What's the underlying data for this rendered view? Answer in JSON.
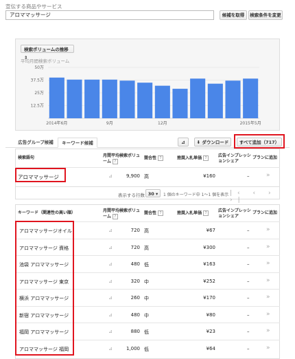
{
  "search": {
    "label": "宣伝する商品やサービス",
    "value": "アロママッサージ",
    "get_button": "候補を取得",
    "change_button": "検索条件を変更"
  },
  "trend": {
    "dropdown": "検索ボリュームの推移",
    "legend": "平均月間検索ボリューム"
  },
  "chart_data": {
    "type": "bar",
    "ylabel": "平均月間検索ボリューム",
    "yticks": [
      "50万",
      "37.5万",
      "25万",
      "12.5万"
    ],
    "ylim": [
      0,
      50000
    ],
    "values": [
      40000,
      38000,
      38000,
      38000,
      37000,
      35000,
      32000,
      29000,
      39000,
      34000,
      37000,
      39000
    ],
    "xticks": [
      "2014年6月",
      "9月",
      "12月",
      "2015年5月"
    ],
    "color": "#4a86e8"
  },
  "tabs": {
    "ad_group": "広告グループ候補",
    "keyword": "キーワード候補"
  },
  "toolbar": {
    "chart_icon": "chart-icon",
    "download": "ダウンロード",
    "add_all": "すべて追加（717）"
  },
  "table1": {
    "headers": {
      "keyword": "検索語句",
      "volume": "月間平均検索ボリューム",
      "competition": "競合性",
      "bid": "推奨入札単価",
      "share": "広告インプレッションシェア",
      "add": "プランに追加"
    },
    "row": {
      "keyword": "アロママッサージ",
      "volume": "9,900",
      "competition": "高",
      "bid": "¥160",
      "share": "–"
    }
  },
  "pager": {
    "label": "表示する行数",
    "rows": "30",
    "range": "1 個のキーワード中 1～1 個を表示"
  },
  "table2": {
    "headers": {
      "keyword": "キーワード（関連性の高い順）",
      "volume": "月間平均検索ボリューム",
      "competition": "競合性",
      "bid": "推奨入札単価",
      "share": "広告インプレッションシェア",
      "add": "プランに追加"
    },
    "rows": [
      {
        "keyword": "アロママッサージオイル",
        "volume": "720",
        "competition": "高",
        "bid": "¥67",
        "share": "–"
      },
      {
        "keyword": "アロママッサージ 資格",
        "volume": "720",
        "competition": "高",
        "bid": "¥300",
        "share": "–"
      },
      {
        "keyword": "池袋 アロママッサージ",
        "volume": "480",
        "competition": "低",
        "bid": "¥163",
        "share": "–"
      },
      {
        "keyword": "アロママッサージ 東京",
        "volume": "320",
        "competition": "中",
        "bid": "¥252",
        "share": "–"
      },
      {
        "keyword": "横浜 アロママッサージ",
        "volume": "260",
        "competition": "中",
        "bid": "¥170",
        "share": "–"
      },
      {
        "keyword": "新宿 アロママッサージ",
        "volume": "480",
        "competition": "中",
        "bid": "¥80",
        "share": "–"
      },
      {
        "keyword": "福岡 アロママッサージ",
        "volume": "880",
        "competition": "低",
        "bid": "¥23",
        "share": "–"
      },
      {
        "keyword": "アロママッサージ 福岡",
        "volume": "1,000",
        "competition": "低",
        "bid": "¥64",
        "share": "–"
      }
    ]
  }
}
